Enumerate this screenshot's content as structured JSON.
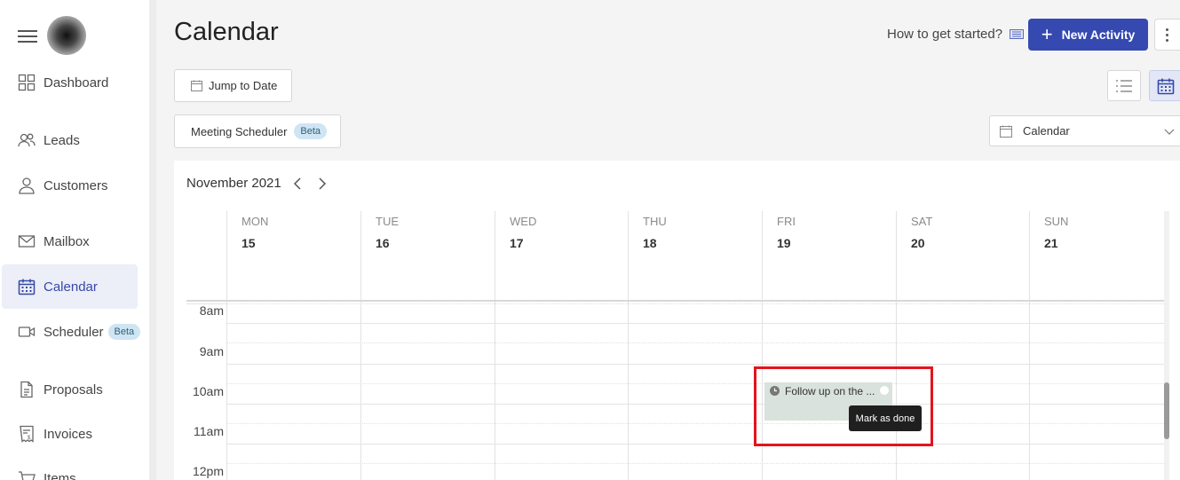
{
  "sidebar": {
    "items": [
      {
        "label": "Dashboard",
        "icon": "dashboard-icon"
      },
      {
        "label": "Leads",
        "icon": "people-icon"
      },
      {
        "label": "Customers",
        "icon": "user-icon"
      },
      {
        "label": "Mailbox",
        "icon": "mail-icon"
      },
      {
        "label": "Calendar",
        "icon": "calendar-icon",
        "active": true
      },
      {
        "label": "Scheduler",
        "icon": "video-icon",
        "badge": "Beta"
      },
      {
        "label": "Proposals",
        "icon": "document-icon"
      },
      {
        "label": "Invoices",
        "icon": "invoice-icon"
      },
      {
        "label": "Items",
        "icon": "cart-icon"
      }
    ]
  },
  "header": {
    "title": "Calendar",
    "help": "How to get started?",
    "new_activity": "New Activity"
  },
  "toolbar": {
    "jump_to_date": "Jump to Date",
    "meeting_scheduler": "Meeting Scheduler",
    "meeting_badge": "Beta",
    "calendar_select": "Calendar"
  },
  "calendar": {
    "month": "November 2021",
    "days": [
      {
        "name": "MON",
        "num": "15"
      },
      {
        "name": "TUE",
        "num": "16"
      },
      {
        "name": "WED",
        "num": "17"
      },
      {
        "name": "THU",
        "num": "18"
      },
      {
        "name": "FRI",
        "num": "19"
      },
      {
        "name": "SAT",
        "num": "20"
      },
      {
        "name": "SUN",
        "num": "21"
      }
    ],
    "hours": [
      "8am",
      "9am",
      "10am",
      "11am",
      "12pm"
    ],
    "event": {
      "title": "Follow up on the ...",
      "tooltip": "Mark as done"
    }
  },
  "colors": {
    "accent": "#3549b0",
    "highlight": "#e3141c",
    "event_bg": "#d9e2dc"
  }
}
